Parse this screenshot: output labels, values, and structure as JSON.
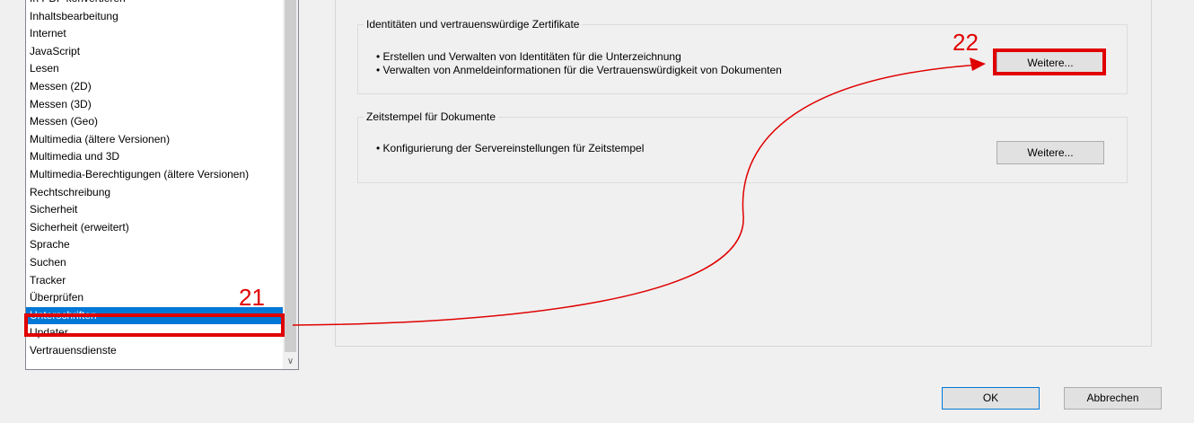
{
  "categories": [
    "In PDF konvertieren",
    "Inhaltsbearbeitung",
    "Internet",
    "JavaScript",
    "Lesen",
    "Messen (2D)",
    "Messen (3D)",
    "Messen (Geo)",
    "Multimedia (ältere Versionen)",
    "Multimedia und 3D",
    "Multimedia-Berechtigungen (ältere Versionen)",
    "Rechtschreibung",
    "Sicherheit",
    "Sicherheit (erweitert)",
    "Sprache",
    "Suchen",
    "Tracker",
    "Überprüfen",
    "Unterschriften",
    "Updater",
    "Vertrauensdienste"
  ],
  "selected_category": "Unterschriften",
  "identities": {
    "title": "Identitäten und vertrauenswürdige Zertifikate",
    "lines": [
      "• Erstellen und Verwalten von Identitäten für die Unterzeichnung",
      "• Verwalten von Anmeldeinformationen für die Vertrauenswürdigkeit von Dokumenten"
    ],
    "button": "Weitere..."
  },
  "timestamp": {
    "title": "Zeitstempel für Dokumente",
    "lines": [
      "• Konfigurierung der Servereinstellungen für Zeitstempel"
    ],
    "button": "Weitere..."
  },
  "footer": {
    "ok": "OK",
    "cancel": "Abbrechen"
  },
  "annotations": {
    "callout_a": "21",
    "callout_b": "22",
    "color": "#e00000"
  },
  "icons": {
    "scroll_down": "chevron-down-icon"
  }
}
